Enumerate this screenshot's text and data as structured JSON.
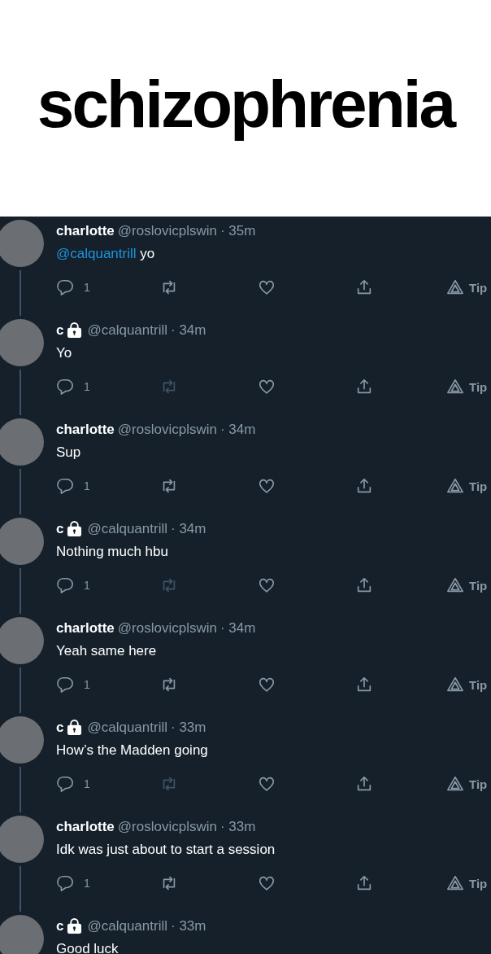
{
  "caption": "schizophrenia",
  "tweets": [
    {
      "name": "charlotte",
      "locked": false,
      "handle": "@roslovicplswin",
      "time": "· 35m",
      "mention": "@calquantrill",
      "text": " yo",
      "replies": "1",
      "retweet_disabled": false,
      "tip": "Tip",
      "thread": true
    },
    {
      "name": "c",
      "locked": true,
      "handle": "@calquantrill",
      "time": "· 34m",
      "text": "Yo",
      "replies": "1",
      "retweet_disabled": true,
      "tip": "Tip",
      "thread": true
    },
    {
      "name": "charlotte",
      "locked": false,
      "handle": "@roslovicplswin",
      "time": "· 34m",
      "text": "Sup",
      "replies": "1",
      "retweet_disabled": false,
      "tip": "Tip",
      "thread": true
    },
    {
      "name": "c",
      "locked": true,
      "handle": "@calquantrill",
      "time": "· 34m",
      "text": "Nothing much hbu",
      "replies": "1",
      "retweet_disabled": true,
      "tip": "Tip",
      "thread": true
    },
    {
      "name": "charlotte",
      "locked": false,
      "handle": "@roslovicplswin",
      "time": "· 34m",
      "text": "Yeah same here",
      "replies": "1",
      "retweet_disabled": false,
      "tip": "Tip",
      "thread": true
    },
    {
      "name": "c",
      "locked": true,
      "handle": "@calquantrill",
      "time": "· 33m",
      "text": "How’s the Madden going",
      "replies": "1",
      "retweet_disabled": true,
      "tip": "Tip",
      "thread": true
    },
    {
      "name": "charlotte",
      "locked": false,
      "handle": "@roslovicplswin",
      "time": "· 33m",
      "text": "Idk was just about to start a session",
      "replies": "1",
      "retweet_disabled": false,
      "tip": "Tip",
      "thread": true
    },
    {
      "name": "c",
      "locked": true,
      "handle": "@calquantrill",
      "time": "· 33m",
      "text": "Good luck",
      "thread": false
    }
  ]
}
